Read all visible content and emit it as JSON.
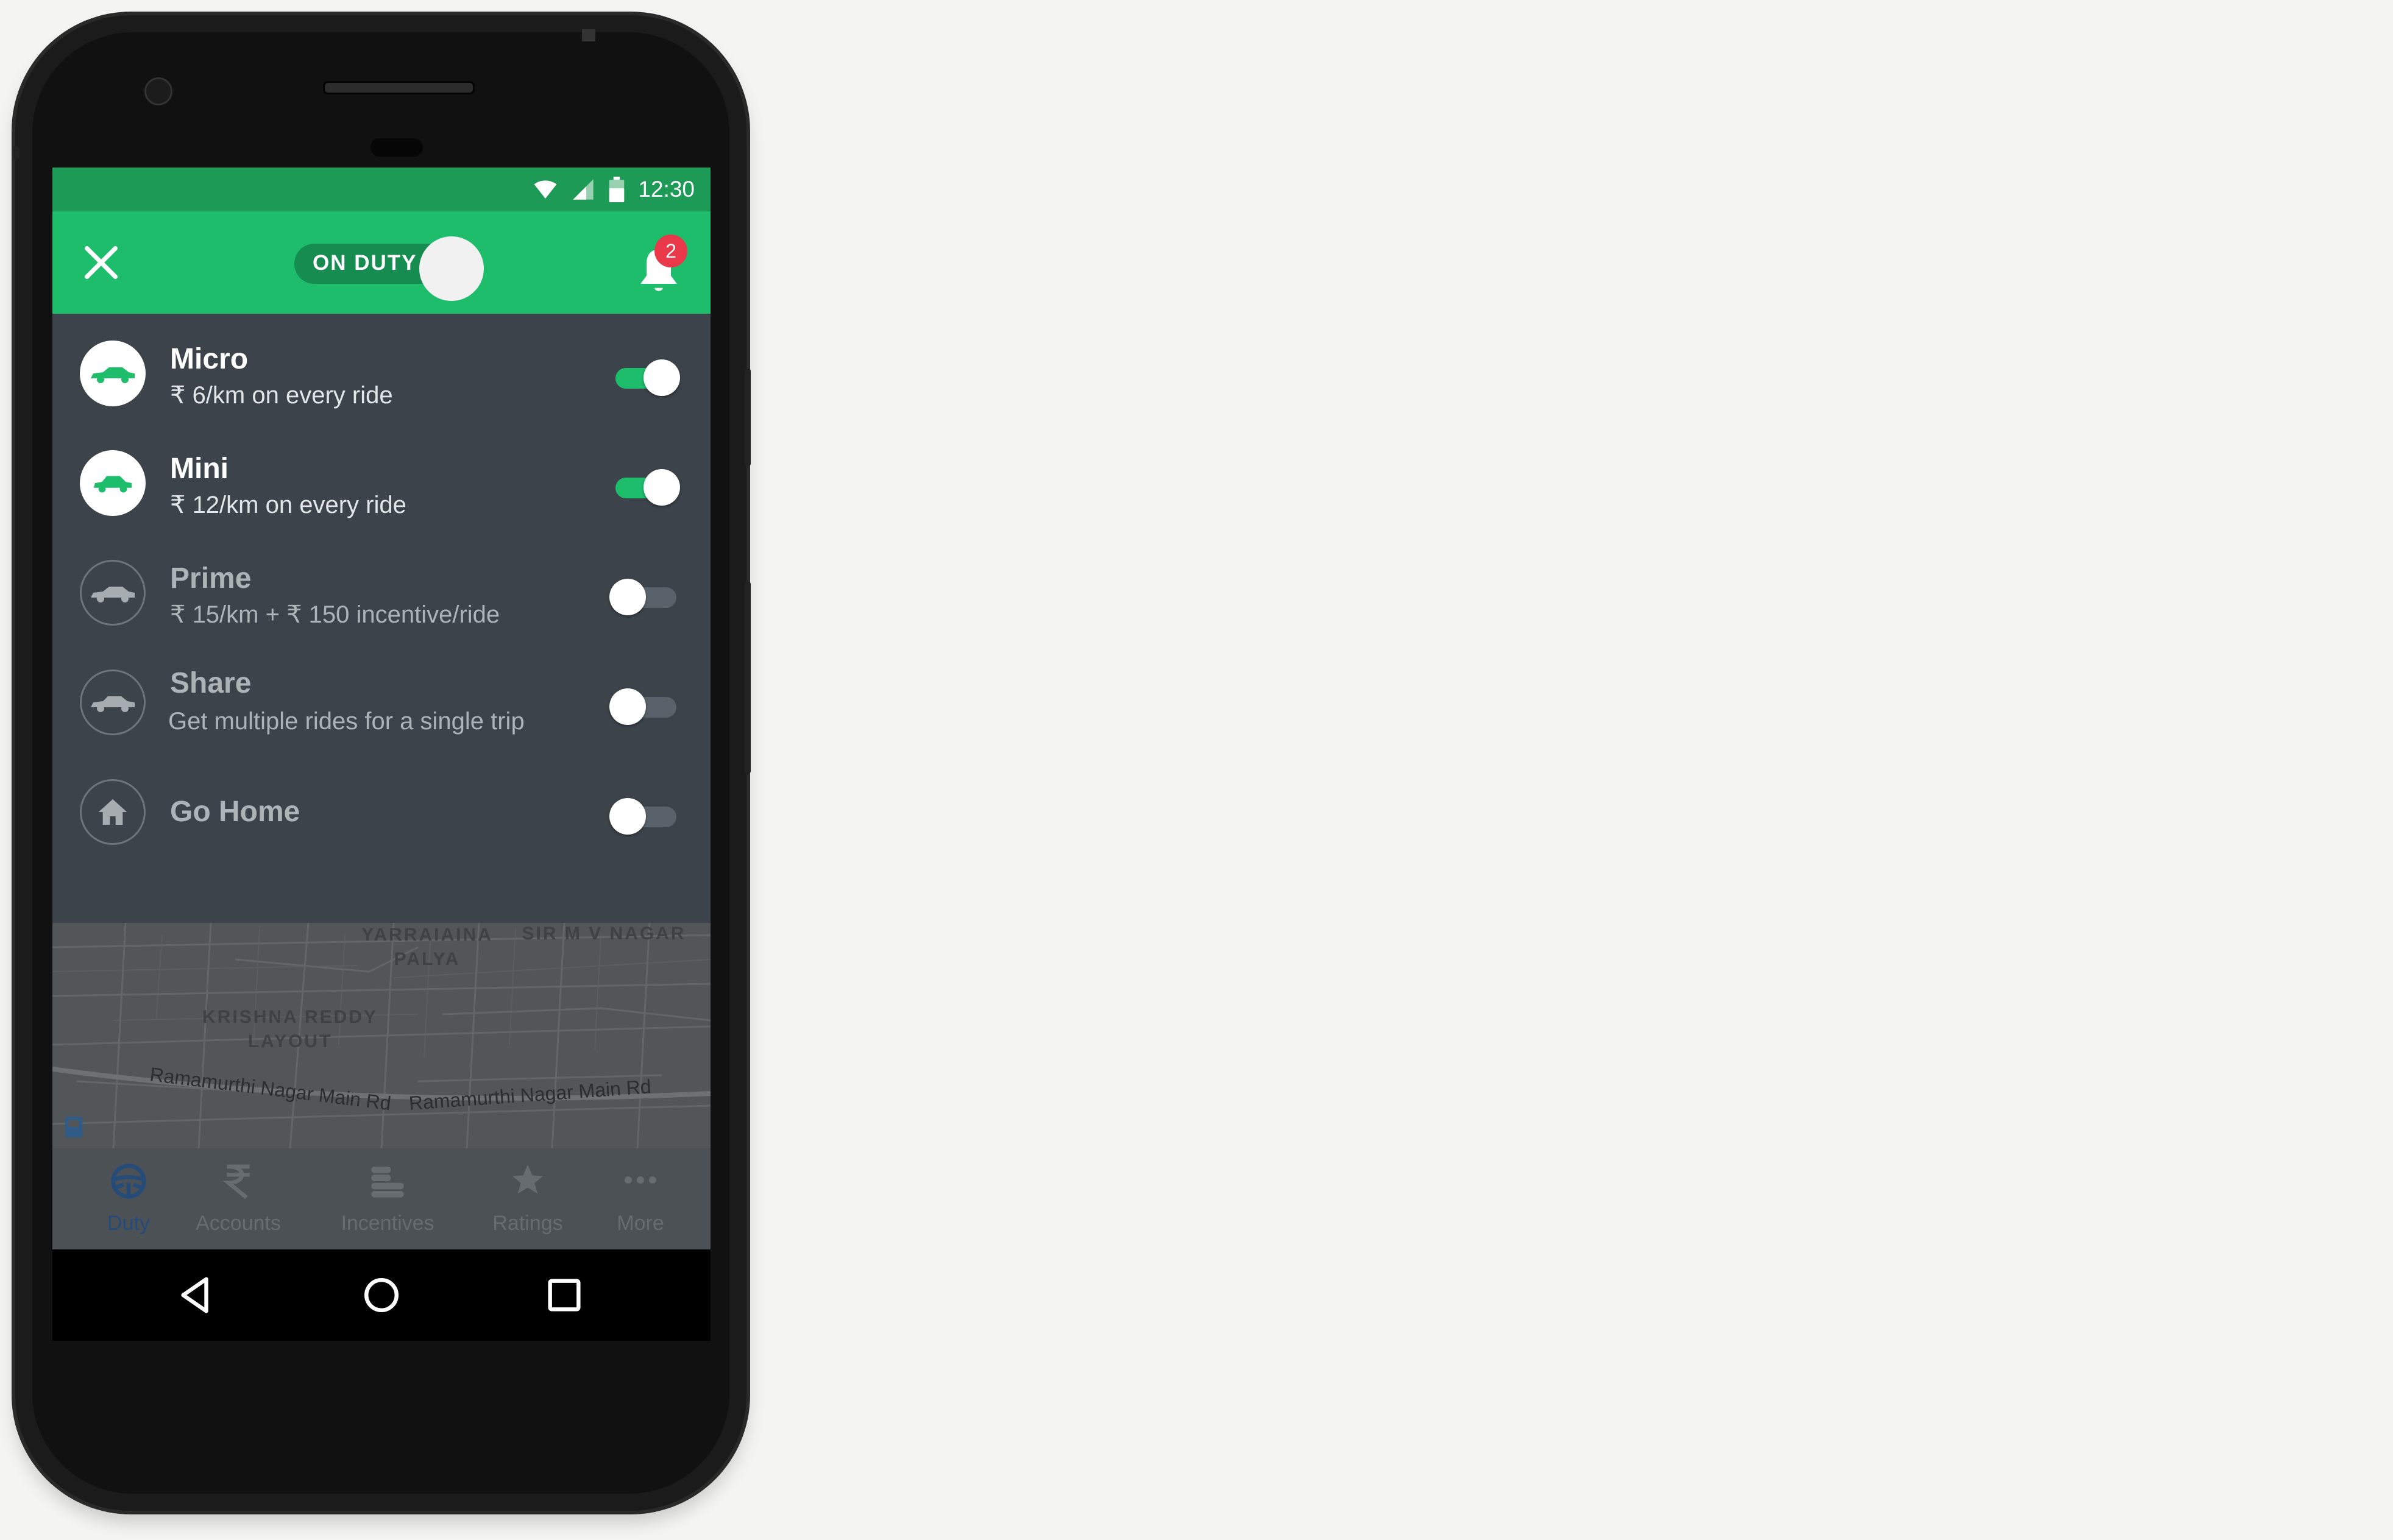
{
  "status_bar": {
    "time": "12:30",
    "icons": [
      "wifi-icon",
      "signal-icon",
      "battery-icon"
    ]
  },
  "app_bar": {
    "close_icon": "close-icon",
    "duty_toggle": {
      "label": "ON DUTY",
      "state": "on"
    },
    "notifications": {
      "icon": "bell-icon",
      "badge_count": "2"
    }
  },
  "categories": [
    {
      "name": "Micro",
      "detail": "₹ 6/km on every ride",
      "enabled": true,
      "icon": "sedan-car-icon"
    },
    {
      "name": "Mini",
      "detail": "₹ 12/km on every ride",
      "enabled": true,
      "icon": "hatchback-car-icon"
    },
    {
      "name": "Prime",
      "detail": "₹ 15/km + ₹ 150 incentive/ride",
      "enabled": false,
      "icon": "sedan-car-icon"
    },
    {
      "name": "Share",
      "detail": "Get multiple rides for a single trip",
      "enabled": false,
      "icon": "car-icon"
    },
    {
      "name": "Go Home",
      "detail": "",
      "enabled": false,
      "icon": "home-icon"
    }
  ],
  "map": {
    "areas": [
      "YARRAIAINA PALYA",
      "SIR M V NAGAR",
      "KRISHNA REDDY LAYOUT"
    ],
    "roads": [
      "Ramamurthi Nagar Main Rd",
      "Ramamurthi Nagar Main Rd"
    ]
  },
  "bottom_nav": [
    {
      "label": "Duty",
      "icon": "steering-wheel-icon",
      "active": true
    },
    {
      "label": "Accounts",
      "icon": "rupee-icon",
      "active": false
    },
    {
      "label": "Incentives",
      "icon": "coins-icon",
      "active": false
    },
    {
      "label": "Ratings",
      "icon": "star-icon",
      "active": false
    },
    {
      "label": "More",
      "icon": "more-dots-icon",
      "active": false
    }
  ],
  "colors": {
    "brand_green": "#1dbd6c",
    "status_green": "#1c9a56",
    "panel": "#3c434a",
    "badge_red": "#e8384a",
    "active_nav": "#254b79"
  }
}
